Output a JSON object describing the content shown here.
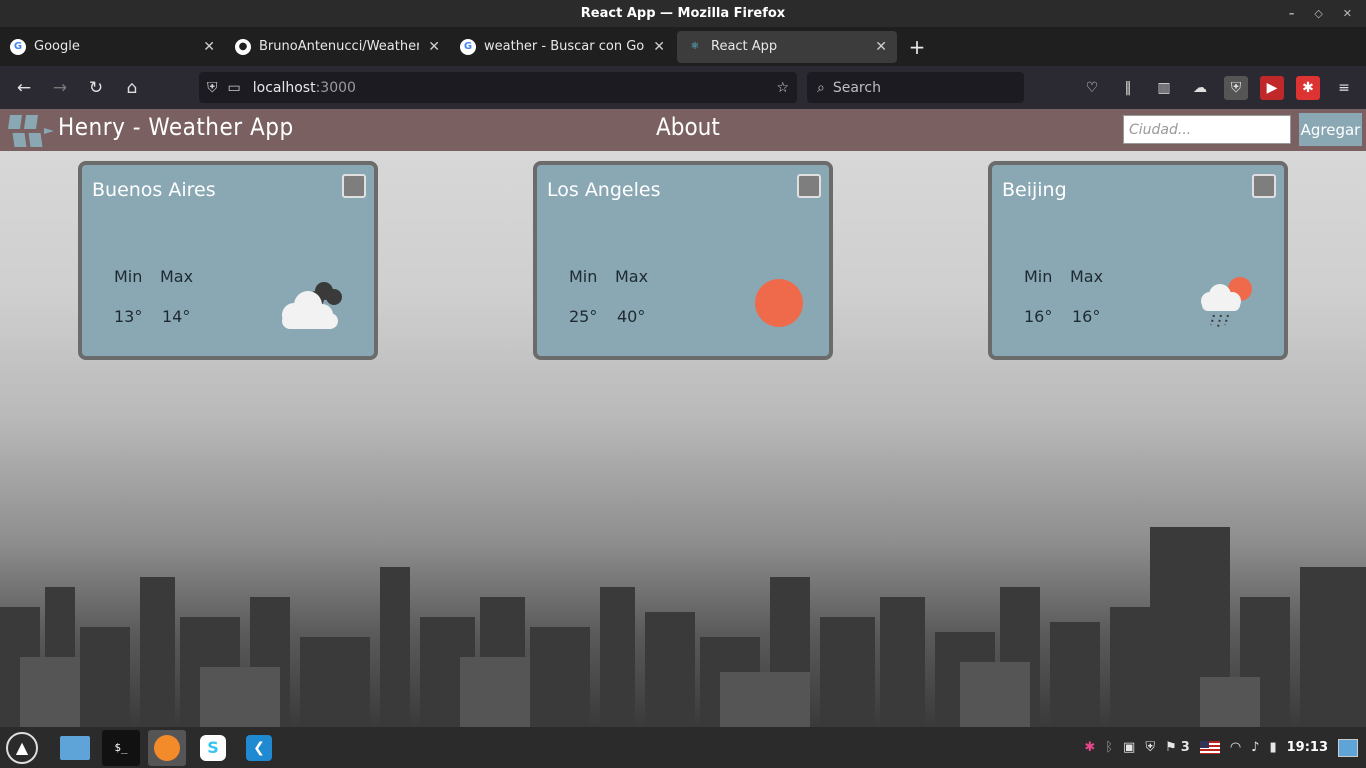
{
  "window": {
    "title": "React App — Mozilla Firefox"
  },
  "tabs": [
    {
      "label": "Google",
      "icon": "google-icon"
    },
    {
      "label": "BrunoAntenucci/WeatherAp",
      "icon": "github-icon"
    },
    {
      "label": "weather - Buscar con Google",
      "icon": "google-icon"
    },
    {
      "label": "React App",
      "icon": "react-icon",
      "active": true
    }
  ],
  "navbar": {
    "url_host": "localhost",
    "url_port": ":3000",
    "search_placeholder": "Search"
  },
  "app": {
    "title": "Henry - Weather App",
    "about": "About",
    "search": {
      "placeholder": "Ciudad...",
      "value": ""
    },
    "add_button": "Agregar"
  },
  "cards": [
    {
      "city": "Buenos Aires",
      "min_label": "Min",
      "max_label": "Max",
      "min": "13°",
      "max": "14°",
      "icon": "dark-clouds-icon"
    },
    {
      "city": "Los Angeles",
      "min_label": "Min",
      "max_label": "Max",
      "min": "25°",
      "max": "40°",
      "icon": "sun-icon"
    },
    {
      "city": "Beijing",
      "min_label": "Min",
      "max_label": "Max",
      "min": "16°",
      "max": "16°",
      "icon": "rain-cloud-sun-icon"
    }
  ],
  "taskbar": {
    "tray_count": "3",
    "clock": "19:13"
  },
  "colors": {
    "app_nav": "#7a6060",
    "card": "#8aa8b4",
    "sun": "#ee6a4b",
    "button": "#8aa8b4"
  }
}
